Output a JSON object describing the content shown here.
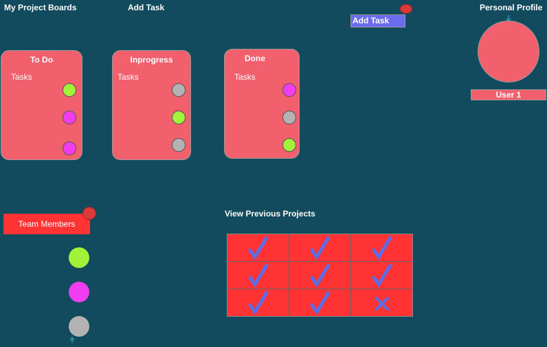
{
  "header": {
    "my_boards": "My Project Boards",
    "add_task": "Add Task",
    "personal_profile": "Personal Profile"
  },
  "add_task_button": {
    "label": "Add Task",
    "color": "#6b6bf0"
  },
  "boards": [
    {
      "title": "To Do",
      "subtitle": "Tasks",
      "tasks": [
        "#a3f23a",
        "#f03df0",
        "#f03df0"
      ]
    },
    {
      "title": "Inprogress",
      "subtitle": "Tasks",
      "tasks": [
        "#b3b3b3",
        "#a3f23a",
        "#b3b3b3"
      ]
    },
    {
      "title": "Done",
      "subtitle": "Tasks",
      "tasks": [
        "#f03df0",
        "#b3b3b3",
        "#a3f23a"
      ]
    }
  ],
  "profile": {
    "user_label": "User 1",
    "avatar_color": "#f25f6d"
  },
  "team": {
    "button_label": "Team Members",
    "members": [
      "#a3f23a",
      "#f03df0",
      "#b3b3b3"
    ]
  },
  "previous_projects": {
    "label": "View Previous Projects",
    "grid": [
      [
        "check-icon",
        "check-icon",
        "check-icon"
      ],
      [
        "check-icon",
        "check-icon",
        "check-icon"
      ],
      [
        "check-icon",
        "check-icon",
        "x-icon"
      ]
    ]
  },
  "colors": {
    "background": "#124a5e",
    "board": "#f25f6d",
    "team_button": "#ff3333",
    "icon": "#5b6ee8"
  }
}
